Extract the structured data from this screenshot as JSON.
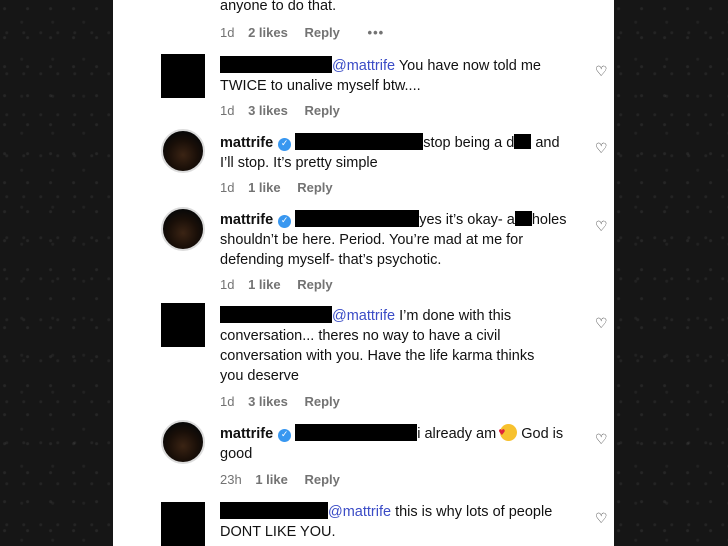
{
  "top_fragment": {
    "text": "anyone to do that.",
    "time": "1d",
    "likes": "2 likes",
    "reply": "Reply",
    "more": "•••"
  },
  "comments": [
    {
      "mention": "@mattrife",
      "text_1": " You have now told me",
      "text_2": "TWICE to unalive myself btw....",
      "time": "1d",
      "likes": "3 likes",
      "reply": "Reply"
    },
    {
      "username": "mattrife",
      "text_1a": "stop being a d",
      "text_1b": " and",
      "text_2": "I’ll stop. It’s pretty simple",
      "time": "1d",
      "likes": "1 like",
      "reply": "Reply"
    },
    {
      "username": "mattrife",
      "text_1a": "yes it’s okay- a",
      "text_1b": "holes",
      "text_2": "shouldn’t be here. Period. You’re mad at me for",
      "text_3": "defending myself- that’s psychotic.",
      "time": "1d",
      "likes": "1 like",
      "reply": "Reply"
    },
    {
      "mention": "@mattrife",
      "text_1": " I’m done with this",
      "text_2": "conversation... theres no way to have a civil",
      "text_3": "conversation with you. Have the life karma thinks",
      "text_4": "you deserve",
      "time": "1d",
      "likes": "3 likes",
      "reply": "Reply"
    },
    {
      "username": "mattrife",
      "text_1a": "i already am ",
      "text_1b": " God is",
      "text_2": "good",
      "time": "23h",
      "likes": "1 like",
      "reply": "Reply"
    },
    {
      "mention": "@mattrife",
      "text_1": " this is why lots of people",
      "text_2": "DONT LIKE YOU."
    }
  ],
  "icons": {
    "heart": "heart-outline-icon",
    "verified": "verified-badge-icon",
    "emoji": "smiling-face-with-hearts-icon"
  },
  "colors": {
    "mention": "#3b4cc6",
    "verified": "#3897f0",
    "meta": "#737373"
  }
}
